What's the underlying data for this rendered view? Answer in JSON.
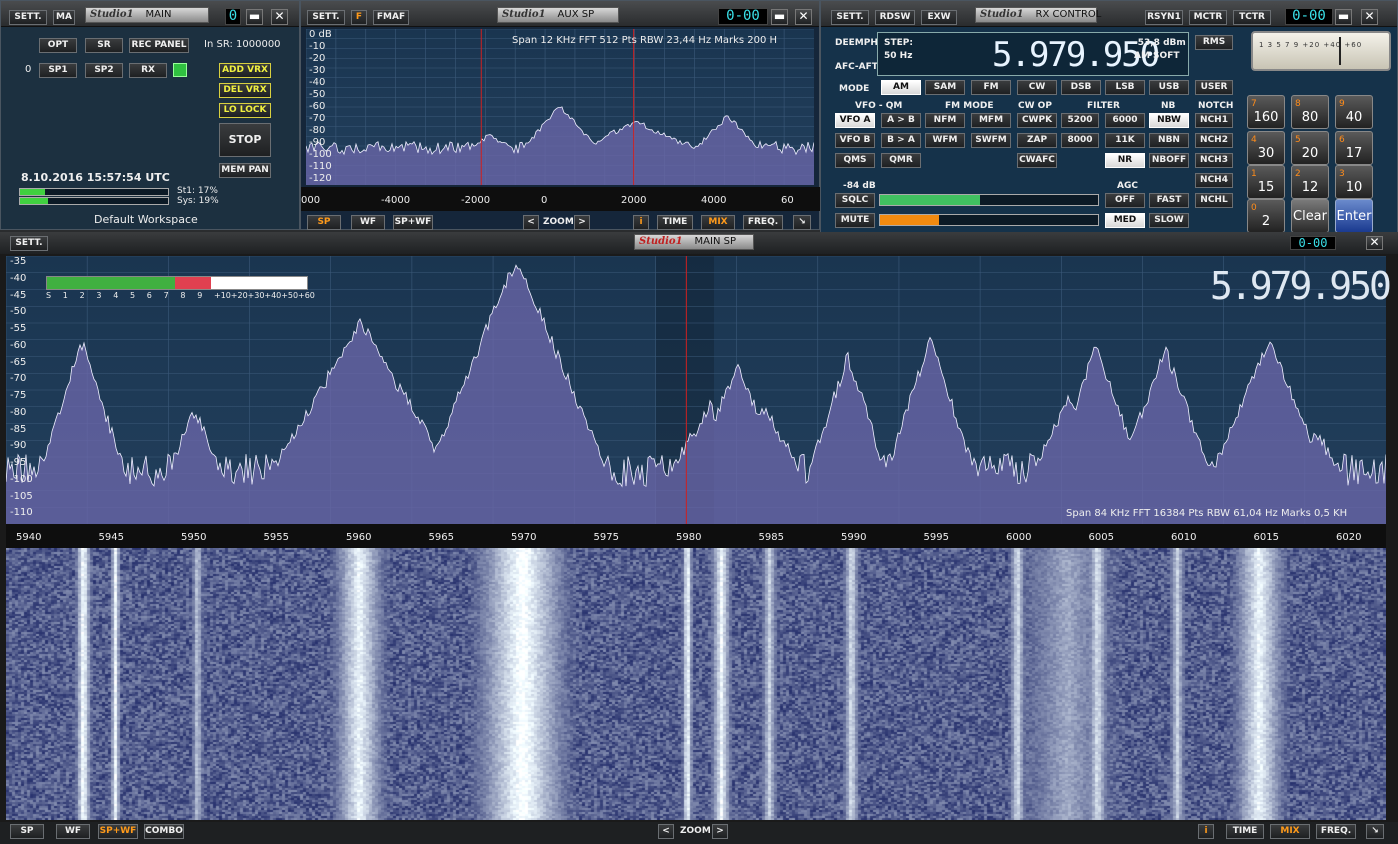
{
  "main_win": {
    "sett": "SETT.",
    "ma": "MA",
    "studio": "Studio1",
    "title": "MAIN",
    "lcd": "0",
    "opt": "OPT",
    "sr": "SR",
    "rec_panel": "REC PANEL",
    "in_sr": "In SR: 1000000",
    "zero": "0",
    "sp1": "SP1",
    "sp2": "SP2",
    "rx": "RX",
    "add_vrx": "ADD VRX",
    "del_vrx": "DEL VRX",
    "lo_lock": "LO LOCK",
    "stop": "STOP",
    "mem_pan": "MEM PAN",
    "datetime": "8.10.2016 15:57:54 UTC",
    "st1": "St1: 17%",
    "sys": "Sys: 19%",
    "workspace": "Default Workspace",
    "st1_level": 0.17,
    "sys_level": 0.19
  },
  "aux_win": {
    "sett": "SETT.",
    "f": "F",
    "fmaf": "FMAF",
    "studio": "Studio1",
    "title": "AUX SP",
    "lcd": "0-00",
    "info": "Span 12 KHz  FFT 512 Pts  RBW 23,44 Hz  Marks 200 H",
    "y_ticks": [
      "0 dB",
      "-10",
      "-20",
      "-30",
      "-40",
      "-50",
      "-60",
      "-70",
      "-80",
      "-90",
      "-100",
      "-110",
      "-120"
    ],
    "x_ticks": [
      "000",
      "-4000",
      "-2000",
      "0",
      "2000",
      "4000",
      "60"
    ],
    "sp": "SP",
    "wf": "WF",
    "spwf": "SP+WF",
    "zoom": "ZOOM",
    "i": "i",
    "time": "TIME",
    "mix": "MIX",
    "freq": "FREQ."
  },
  "rx_win": {
    "sett": "SETT.",
    "rdsw": "RDSW",
    "exw": "EXW",
    "studio": "Studio1",
    "title": "RX CONTROL",
    "rsyn1": "RSYN1",
    "mctr": "MCTR",
    "tctr": "TCTR",
    "lcd": "0-00",
    "deemph": "DEEMPH",
    "afc": "AFC-AFT",
    "step": "STEP:",
    "step_val": "50 Hz",
    "freq": "5.979.950",
    "dbm": "-53,8 dBm",
    "am_soft": "AM SOFT",
    "rms": "RMS",
    "mode_lbl": "MODE",
    "modes": [
      "AM",
      "SAM",
      "FM",
      "CW",
      "DSB",
      "LSB",
      "USB",
      "USER"
    ],
    "vfo_qm": "VFO - QM",
    "fm_mode": "FM MODE",
    "cw_op": "CW OP",
    "filter": "FILTER",
    "nb": "NB",
    "notch": "NOTCH",
    "vfo_a": "VFO A",
    "a_b": "A > B",
    "nfm": "NFM",
    "mfm": "MFM",
    "cwpk": "CWPK",
    "f5200": "5200",
    "f6000": "6000",
    "nbw": "NBW",
    "nch1": "NCH1",
    "vfo_b": "VFO B",
    "b_a": "B > A",
    "wfm": "WFM",
    "swfm": "SWFM",
    "zap": "ZAP",
    "f8000": "8000",
    "f11k": "11K",
    "nbn": "NBN",
    "nch2": "NCH2",
    "qms": "QMS",
    "qmr": "QMR",
    "cwafc": "CWAFC",
    "nr": "NR",
    "nboff": "NBOFF",
    "nch3": "NCH3",
    "nch4": "NCH4",
    "sq_db": "-84 dB",
    "agc": "AGC",
    "sqlc": "SQLC",
    "off": "OFF",
    "fast": "FAST",
    "nchl": "NCHL",
    "mute": "MUTE",
    "med": "MED",
    "slow": "SLOW",
    "sqlc_level": 0.46,
    "mute_level": 0.27,
    "meter_scale": "1 3 5 7 9 +20 +40 +60",
    "keypad": [
      {
        "sup": "7",
        "v": "160"
      },
      {
        "sup": "8",
        "v": "80"
      },
      {
        "sup": "9",
        "v": "40"
      },
      {
        "sup": "4",
        "v": "30"
      },
      {
        "sup": "5",
        "v": "20"
      },
      {
        "sup": "6",
        "v": "17"
      },
      {
        "sup": "1",
        "v": "15"
      },
      {
        "sup": "2",
        "v": "12"
      },
      {
        "sup": "3",
        "v": "10"
      },
      {
        "sup": "0",
        "v": "2"
      }
    ],
    "clear": "Clear",
    "enter": "Enter"
  },
  "main_sp": {
    "sett": "SETT.",
    "studio": "Studio1",
    "title": "MAIN SP",
    "lcd": "0-00",
    "freq": "5.979.950",
    "y_ticks": [
      "-35",
      "-40",
      "-45",
      "-50",
      "-55",
      "-60",
      "-65",
      "-70",
      "-75",
      "-80",
      "-85",
      "-90",
      "-95",
      "-100",
      "-105",
      "-110"
    ],
    "x_ticks": [
      "5940",
      "5945",
      "5950",
      "5955",
      "5960",
      "5965",
      "5970",
      "5975",
      "5980",
      "5985",
      "5990",
      "5995",
      "6000",
      "6005",
      "6010",
      "6015",
      "6020"
    ],
    "smeter_labels": [
      "S",
      "1",
      "2",
      "3",
      "4",
      "5",
      "6",
      "7",
      "8",
      "9",
      "+10",
      "+20",
      "+30",
      "+40",
      "+50",
      "+60"
    ],
    "smeter_level": 0.63,
    "info": "Span 84 KHz   FFT 16384 Pts   RBW 61,04 Hz   Marks 0,5 KH",
    "sp": "SP",
    "wf": "WF",
    "spwf": "SP+WF",
    "combo": "COMBO",
    "zoom": "ZOOM",
    "i": "i",
    "time": "TIME",
    "mix": "MIX",
    "freq_btn": "FREQ."
  },
  "colors": {
    "accent_orange": "#ff9a1a",
    "lcd_cyan": "#3ae0e8",
    "spectrum_fill": "#7a74b8",
    "marker_red": "#d02020"
  }
}
